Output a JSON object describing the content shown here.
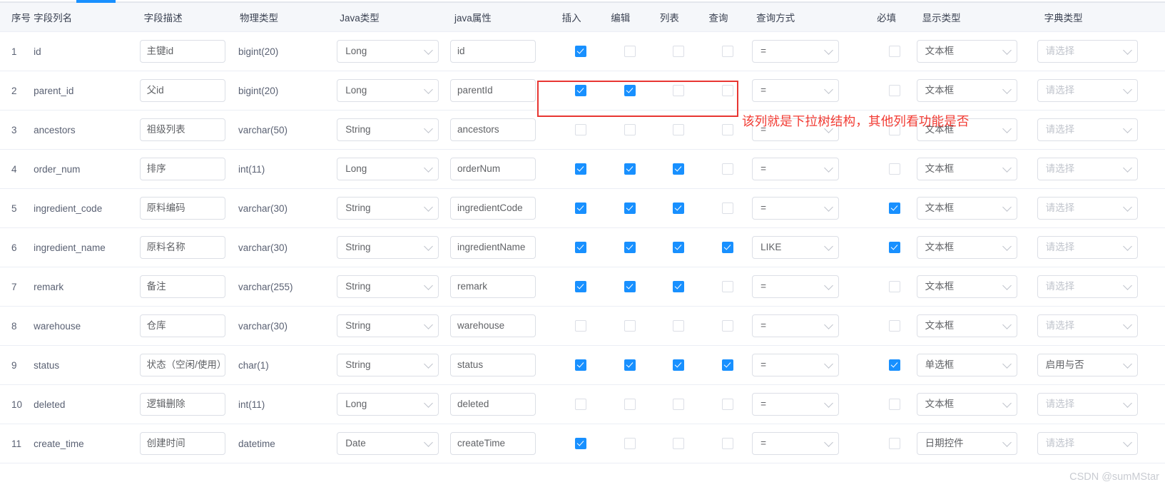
{
  "tabs": {
    "active_indicator": true
  },
  "colors": {
    "accent": "#1890ff",
    "annotation": "#f23b33",
    "header_bg": "#f5f7fa",
    "border": "#ebeef5",
    "placeholder": "#c0c4cc"
  },
  "table": {
    "headers": {
      "seq": "序号",
      "column_name": "字段列名",
      "column_desc": "字段描述",
      "physical_type": "物理类型",
      "java_type": "Java类型",
      "java_field": "java属性",
      "insert": "插入",
      "edit": "编辑",
      "list": "列表",
      "query": "查询",
      "query_type": "查询方式",
      "required": "必填",
      "display_type": "显示类型",
      "dict_type": "字典类型"
    },
    "rows": [
      {
        "seq": "1",
        "column_name": "id",
        "column_desc": "主键id",
        "physical_type": "bigint(20)",
        "java_type": "Long",
        "java_field": "id",
        "insert": true,
        "edit": false,
        "list": false,
        "query": false,
        "query_type": "=",
        "required": false,
        "display_type": "文本框",
        "dict_type": "请选择",
        "dict_is_placeholder": true
      },
      {
        "seq": "2",
        "column_name": "parent_id",
        "column_desc": "父id",
        "physical_type": "bigint(20)",
        "java_type": "Long",
        "java_field": "parentId",
        "insert": true,
        "edit": true,
        "list": false,
        "query": false,
        "query_type": "=",
        "required": false,
        "display_type": "文本框",
        "dict_type": "请选择",
        "dict_is_placeholder": true
      },
      {
        "seq": "3",
        "column_name": "ancestors",
        "column_desc": "祖级列表",
        "physical_type": "varchar(50)",
        "java_type": "String",
        "java_field": "ancestors",
        "insert": false,
        "edit": false,
        "list": false,
        "query": false,
        "query_type": "=",
        "required": false,
        "display_type": "文本框",
        "dict_type": "请选择",
        "dict_is_placeholder": true
      },
      {
        "seq": "4",
        "column_name": "order_num",
        "column_desc": "排序",
        "physical_type": "int(11)",
        "java_type": "Long",
        "java_field": "orderNum",
        "insert": true,
        "edit": true,
        "list": true,
        "query": false,
        "query_type": "=",
        "required": false,
        "display_type": "文本框",
        "dict_type": "请选择",
        "dict_is_placeholder": true
      },
      {
        "seq": "5",
        "column_name": "ingredient_code",
        "column_desc": "原料编码",
        "physical_type": "varchar(30)",
        "java_type": "String",
        "java_field": "ingredientCode",
        "insert": true,
        "edit": true,
        "list": true,
        "query": false,
        "query_type": "=",
        "required": true,
        "display_type": "文本框",
        "dict_type": "请选择",
        "dict_is_placeholder": true
      },
      {
        "seq": "6",
        "column_name": "ingredient_name",
        "column_desc": "原料名称",
        "physical_type": "varchar(30)",
        "java_type": "String",
        "java_field": "ingredientName",
        "insert": true,
        "edit": true,
        "list": true,
        "query": true,
        "query_type": "LIKE",
        "required": true,
        "display_type": "文本框",
        "dict_type": "请选择",
        "dict_is_placeholder": true
      },
      {
        "seq": "7",
        "column_name": "remark",
        "column_desc": "备注",
        "physical_type": "varchar(255)",
        "java_type": "String",
        "java_field": "remark",
        "insert": true,
        "edit": true,
        "list": true,
        "query": false,
        "query_type": "=",
        "required": false,
        "display_type": "文本框",
        "dict_type": "请选择",
        "dict_is_placeholder": true
      },
      {
        "seq": "8",
        "column_name": "warehouse",
        "column_desc": "仓库",
        "physical_type": "varchar(30)",
        "java_type": "String",
        "java_field": "warehouse",
        "insert": false,
        "edit": false,
        "list": false,
        "query": false,
        "query_type": "=",
        "required": false,
        "display_type": "文本框",
        "dict_type": "请选择",
        "dict_is_placeholder": true
      },
      {
        "seq": "9",
        "column_name": "status",
        "column_desc": "状态（空闲/使用）",
        "physical_type": "char(1)",
        "java_type": "String",
        "java_field": "status",
        "insert": true,
        "edit": true,
        "list": true,
        "query": true,
        "query_type": "=",
        "required": true,
        "display_type": "单选框",
        "dict_type": "启用与否",
        "dict_is_placeholder": false
      },
      {
        "seq": "10",
        "column_name": "deleted",
        "column_desc": "逻辑删除",
        "physical_type": "int(11)",
        "java_type": "Long",
        "java_field": "deleted",
        "insert": false,
        "edit": false,
        "list": false,
        "query": false,
        "query_type": "=",
        "required": false,
        "display_type": "文本框",
        "dict_type": "请选择",
        "dict_is_placeholder": true
      },
      {
        "seq": "11",
        "column_name": "create_time",
        "column_desc": "创建时间",
        "physical_type": "datetime",
        "java_type": "Date",
        "java_field": "createTime",
        "insert": true,
        "edit": false,
        "list": false,
        "query": false,
        "query_type": "=",
        "required": false,
        "display_type": "日期控件",
        "dict_type": "请选择",
        "dict_is_placeholder": true
      }
    ]
  },
  "annotation": {
    "note_text": "该列就是下拉树结构，其他列看功能是否"
  },
  "watermark": "CSDN @sumMStar"
}
